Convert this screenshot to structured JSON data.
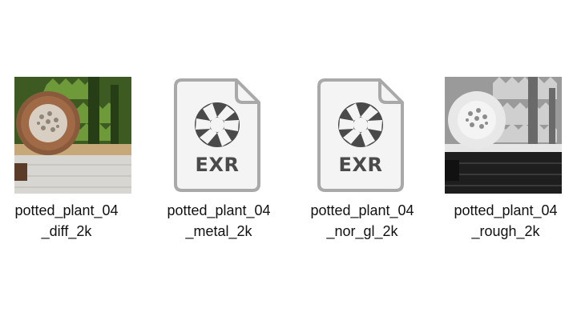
{
  "files": [
    {
      "name_line1": "potted_plant_04",
      "name_line2": "_diff_2k",
      "icon": "image-thumbnail-diffuse"
    },
    {
      "name_line1": "potted_plant_04",
      "name_line2": "_metal_2k",
      "icon": "exr-file-icon",
      "type_label": "EXR"
    },
    {
      "name_line1": "potted_plant_04",
      "name_line2": "_nor_gl_2k",
      "icon": "exr-file-icon",
      "type_label": "EXR"
    },
    {
      "name_line1": "potted_plant_04",
      "name_line2": "_rough_2k",
      "icon": "image-thumbnail-roughness"
    }
  ],
  "colors": {
    "doc_border": "#a9a9a9",
    "doc_fill": "#f4f4f4",
    "aperture": "#4a4a4a",
    "label_text": "#111111"
  }
}
